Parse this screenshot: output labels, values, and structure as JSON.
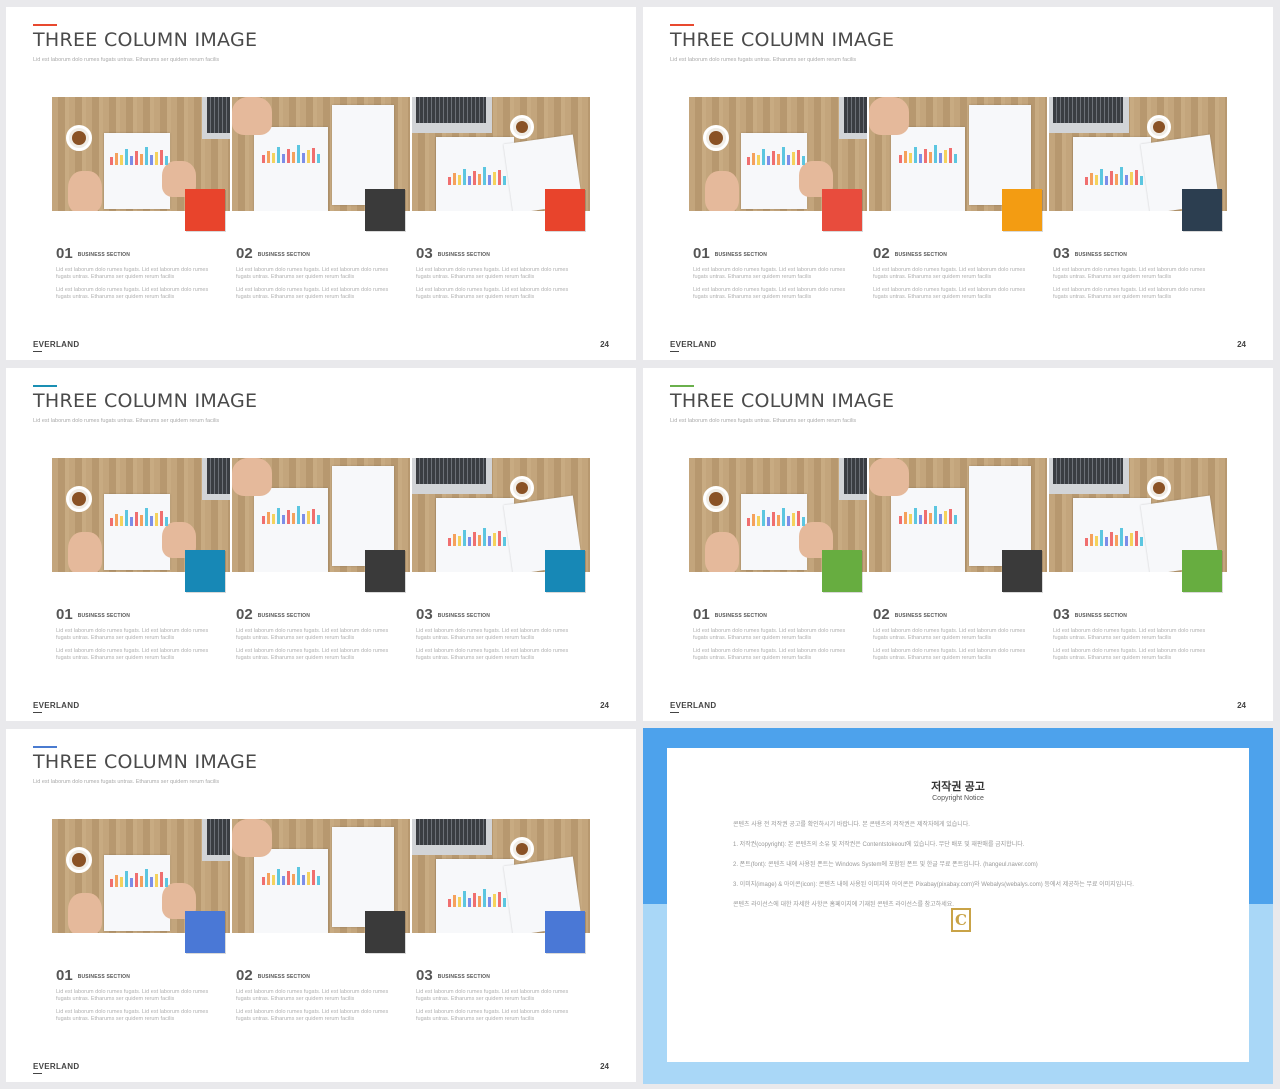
{
  "slides": [
    {
      "title": "THREE COLUMN IMAGE",
      "subtitle": "Lid est laborum dolo rumes fugats untras. Etharums ser quidem rerum facilis",
      "brand": "EVERLAND",
      "page": "24",
      "accent": "#e8492f",
      "squares": [
        "#e8442c",
        "#3a3a3a",
        "#e8442c"
      ],
      "columns": [
        {
          "num": "01",
          "label": "BUSINESS SECTION",
          "p1": "Lid est laborum dolo rumes fugats. Lid est laborum dolo rumes fugats untras. Etharums ser quidem rerum facilis",
          "p2": "Lid est laborum dolo rumes fugats. Lid est laborum dolo rumes fugats untras. Etharums ser quidem rerum facilis"
        },
        {
          "num": "02",
          "label": "BUSINESS SECTION",
          "p1": "Lid est laborum dolo rumes fugats. Lid est laborum dolo rumes fugats untras. Etharums ser quidem rerum facilis",
          "p2": "Lid est laborum dolo rumes fugats. Lid est laborum dolo rumes fugats untras. Etharums ser quidem rerum facilis"
        },
        {
          "num": "03",
          "label": "BUSINESS SECTION",
          "p1": "Lid est laborum dolo rumes fugats. Lid est laborum dolo rumes fugats untras. Etharums ser quidem rerum facilis",
          "p2": "Lid est laborum dolo rumes fugats. Lid est laborum dolo rumes fugats untras. Etharums ser quidem rerum facilis"
        }
      ]
    },
    {
      "title": "THREE COLUMN IMAGE",
      "subtitle": "Lid est laborum dolo rumes fugats untras. Etharums ser quidem rerum facilis",
      "brand": "EVERLAND",
      "page": "24",
      "accent": "#e8492f",
      "squares": [
        "#e84c3d",
        "#f39c12",
        "#2c3e50"
      ],
      "columns": [
        {
          "num": "01",
          "label": "BUSINESS SECTION",
          "p1": "Lid est laborum dolo rumes fugats. Lid est laborum dolo rumes fugats untras. Etharums ser quidem rerum facilis",
          "p2": "Lid est laborum dolo rumes fugats. Lid est laborum dolo rumes fugats untras. Etharums ser quidem rerum facilis"
        },
        {
          "num": "02",
          "label": "BUSINESS SECTION",
          "p1": "Lid est laborum dolo rumes fugats. Lid est laborum dolo rumes fugats untras. Etharums ser quidem rerum facilis",
          "p2": "Lid est laborum dolo rumes fugats. Lid est laborum dolo rumes fugats untras. Etharums ser quidem rerum facilis"
        },
        {
          "num": "03",
          "label": "BUSINESS SECTION",
          "p1": "Lid est laborum dolo rumes fugats. Lid est laborum dolo rumes fugats untras. Etharums ser quidem rerum facilis",
          "p2": "Lid est laborum dolo rumes fugats. Lid est laborum dolo rumes fugats untras. Etharums ser quidem rerum facilis"
        }
      ]
    },
    {
      "title": "THREE COLUMN IMAGE",
      "subtitle": "Lid est laborum dolo rumes fugats untras. Etharums ser quidem rerum facilis",
      "brand": "EVERLAND",
      "page": "24",
      "accent": "#1a8fb3",
      "squares": [
        "#1788b6",
        "#3a3a3a",
        "#1788b6"
      ],
      "columns": [
        {
          "num": "01",
          "label": "BUSINESS SECTION",
          "p1": "Lid est laborum dolo rumes fugats. Lid est laborum dolo rumes fugats untras. Etharums ser quidem rerum facilis",
          "p2": "Lid est laborum dolo rumes fugats. Lid est laborum dolo rumes fugats untras. Etharums ser quidem rerum facilis"
        },
        {
          "num": "02",
          "label": "BUSINESS SECTION",
          "p1": "Lid est laborum dolo rumes fugats. Lid est laborum dolo rumes fugats untras. Etharums ser quidem rerum facilis",
          "p2": "Lid est laborum dolo rumes fugats. Lid est laborum dolo rumes fugats untras. Etharums ser quidem rerum facilis"
        },
        {
          "num": "03",
          "label": "BUSINESS SECTION",
          "p1": "Lid est laborum dolo rumes fugats. Lid est laborum dolo rumes fugats untras. Etharums ser quidem rerum facilis",
          "p2": "Lid est laborum dolo rumes fugats. Lid est laborum dolo rumes fugats untras. Etharums ser quidem rerum facilis"
        }
      ]
    },
    {
      "title": "THREE COLUMN IMAGE",
      "subtitle": "Lid est laborum dolo rumes fugats untras. Etharums ser quidem rerum facilis",
      "brand": "EVERLAND",
      "page": "24",
      "accent": "#6ab04c",
      "squares": [
        "#67ad40",
        "#3a3a3a",
        "#67ad40"
      ],
      "columns": [
        {
          "num": "01",
          "label": "BUSINESS SECTION",
          "p1": "Lid est laborum dolo rumes fugats. Lid est laborum dolo rumes fugats untras. Etharums ser quidem rerum facilis",
          "p2": "Lid est laborum dolo rumes fugats. Lid est laborum dolo rumes fugats untras. Etharums ser quidem rerum facilis"
        },
        {
          "num": "02",
          "label": "BUSINESS SECTION",
          "p1": "Lid est laborum dolo rumes fugats. Lid est laborum dolo rumes fugats untras. Etharums ser quidem rerum facilis",
          "p2": "Lid est laborum dolo rumes fugats. Lid est laborum dolo rumes fugats untras. Etharums ser quidem rerum facilis"
        },
        {
          "num": "03",
          "label": "BUSINESS SECTION",
          "p1": "Lid est laborum dolo rumes fugats. Lid est laborum dolo rumes fugats untras. Etharums ser quidem rerum facilis",
          "p2": "Lid est laborum dolo rumes fugats. Lid est laborum dolo rumes fugats untras. Etharums ser quidem rerum facilis"
        }
      ]
    },
    {
      "title": "THREE COLUMN IMAGE",
      "subtitle": "Lid est laborum dolo rumes fugats untras. Etharums ser quidem rerum facilis",
      "brand": "EVERLAND",
      "page": "24",
      "accent": "#4a7bd0",
      "squares": [
        "#4a78d6",
        "#3a3a3a",
        "#4a78d6"
      ],
      "columns": [
        {
          "num": "01",
          "label": "BUSINESS SECTION",
          "p1": "Lid est laborum dolo rumes fugats. Lid est laborum dolo rumes fugats untras. Etharums ser quidem rerum facilis",
          "p2": "Lid est laborum dolo rumes fugats. Lid est laborum dolo rumes fugats untras. Etharums ser quidem rerum facilis"
        },
        {
          "num": "02",
          "label": "BUSINESS SECTION",
          "p1": "Lid est laborum dolo rumes fugats. Lid est laborum dolo rumes fugats untras. Etharums ser quidem rerum facilis",
          "p2": "Lid est laborum dolo rumes fugats. Lid est laborum dolo rumes fugats untras. Etharums ser quidem rerum facilis"
        },
        {
          "num": "03",
          "label": "BUSINESS SECTION",
          "p1": "Lid est laborum dolo rumes fugats. Lid est laborum dolo rumes fugats untras. Etharums ser quidem rerum facilis",
          "p2": "Lid est laborum dolo rumes fugats. Lid est laborum dolo rumes fugats untras. Etharums ser quidem rerum facilis"
        }
      ]
    }
  ],
  "notice": {
    "title": "저작권 공고",
    "subtitle": "Copyright Notice",
    "p0": "콘텐츠 사용 전 저작권 공고를 확인하시기 바랍니다. 본 콘텐츠의 저작권은 제작자에게 있습니다.",
    "p1": "1. 저작권(copyright): 본 콘텐츠의 소유 및 저작권은 Contentstokeout에 있습니다. 무단 배포 및 재판매를 금지합니다.",
    "p2": "2. 폰트(font): 콘텐츠 내에 사용된 폰트는 Windows System에 포함된 폰트 및 한글 무료 폰트입니다. (hangeul.naver.com)",
    "p3": "3. 이미지(image) & 아이콘(icon): 콘텐츠 내에 사용된 이미지와 아이콘은 Pixabay(pixabay.com)와 Webalys(webalys.com) 등에서 제공하는 무료 이미지입니다.",
    "p4": "콘텐츠 라이선스에 대한 자세한 사항은 홈페이지에 기재된 콘텐츠 라이선스를 참고하세요.",
    "logo": "C"
  }
}
